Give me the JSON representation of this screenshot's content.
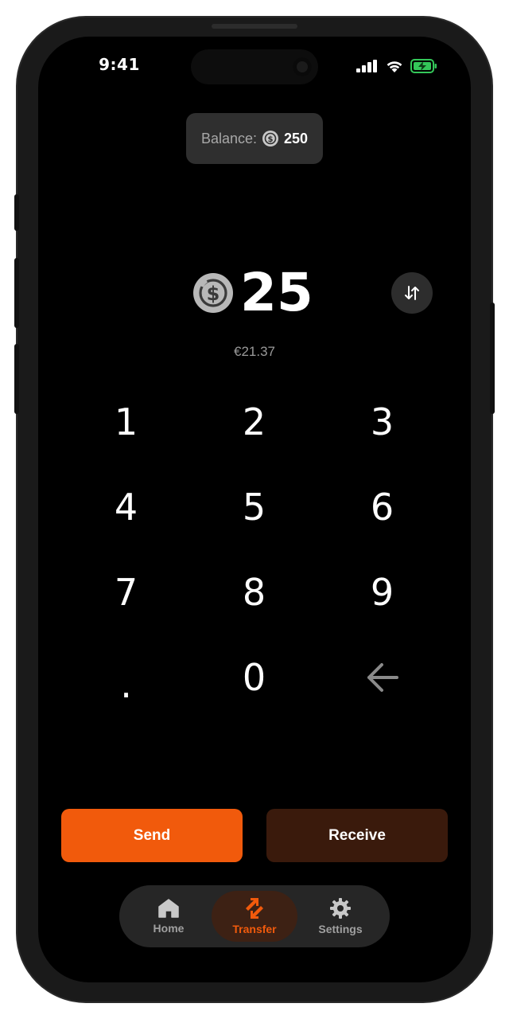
{
  "status_bar": {
    "time": "9:41",
    "icons": [
      "signal-icon",
      "wifi-icon",
      "battery-charging-icon"
    ]
  },
  "balance": {
    "label": "Balance:",
    "currency_icon": "usdc-coin-icon",
    "value": "250"
  },
  "amount": {
    "currency_icon": "usdc-coin-icon",
    "value": "25",
    "fiat_equivalent": "€21.37",
    "swap_icon": "swap-vertical-icon"
  },
  "keypad": {
    "keys": [
      "1",
      "2",
      "3",
      "4",
      "5",
      "6",
      "7",
      "8",
      "9",
      ".",
      "0"
    ],
    "backspace_icon": "arrow-left-icon"
  },
  "actions": {
    "send_label": "Send",
    "receive_label": "Receive"
  },
  "nav": {
    "items": [
      {
        "label": "Home",
        "icon": "home-icon",
        "active": false
      },
      {
        "label": "Transfer",
        "icon": "transfer-icon",
        "active": true
      },
      {
        "label": "Settings",
        "icon": "gear-icon",
        "active": false
      }
    ]
  },
  "colors": {
    "accent": "#f15a0c",
    "receive_bg": "#3a1a0c",
    "battery": "#34c759"
  }
}
